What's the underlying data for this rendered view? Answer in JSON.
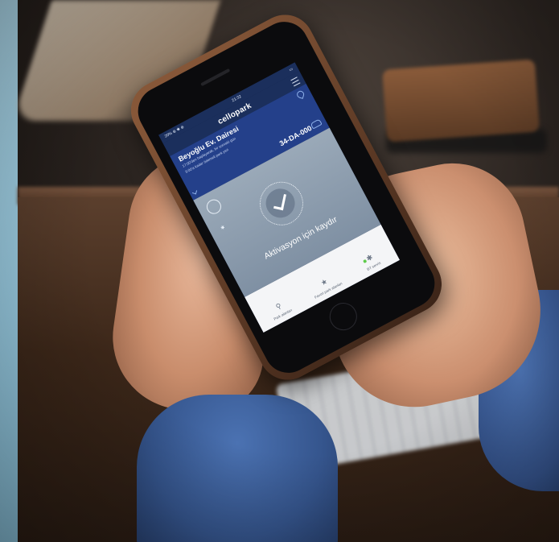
{
  "status_bar": {
    "left": "20% ⊕ ✱ ⊕",
    "time": "21:32"
  },
  "app": {
    "logo": "cellopark"
  },
  "location": {
    "title": "Beyoğlu Ev. Dairesi",
    "description_line1": "17:00'den başlayarak, bir sonraki gün",
    "description_line2": "9:00'a kadar ödemeli park yeri",
    "plate": "34-DA-000"
  },
  "activation": {
    "label": "Aktivasyon için kaydır"
  },
  "nav": {
    "items": [
      {
        "label": "Park alanları",
        "icon": "parking-icon"
      },
      {
        "label": "Favori park alanları",
        "icon": "star-icon"
      },
      {
        "label": "BT servis",
        "icon": "bluetooth-icon"
      }
    ]
  },
  "colors": {
    "header": "#1b2f5c",
    "card": "#24408a",
    "bt_active": "#5ecb4a"
  }
}
